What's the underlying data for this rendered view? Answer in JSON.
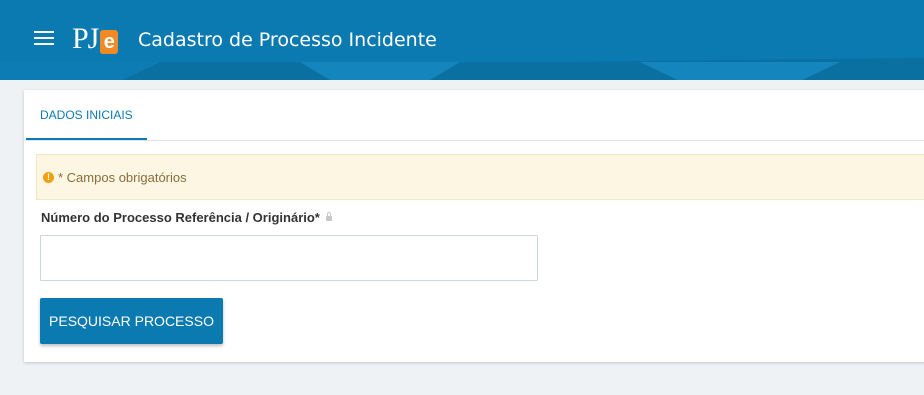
{
  "header": {
    "menu_icon": "hamburger-menu-icon",
    "logo_text": "PJ",
    "logo_accent": "e",
    "title": "Cadastro de Processo Incidente"
  },
  "tabs": [
    {
      "label": "DADOS INICIAIS",
      "active": true
    }
  ],
  "alert": {
    "icon": "warning-icon",
    "text": "* Campos obrigatórios"
  },
  "form": {
    "field_label": "Número do Processo Referência / Originário*",
    "lock_icon": "lock-icon",
    "field_value": "",
    "search_button_label": "PESQUISAR PROCESSO"
  },
  "colors": {
    "primary": "#0b7ab0",
    "logo_accent": "#f08a24",
    "alert_background": "#fcf6e3",
    "alert_icon": "#f0a00c"
  }
}
